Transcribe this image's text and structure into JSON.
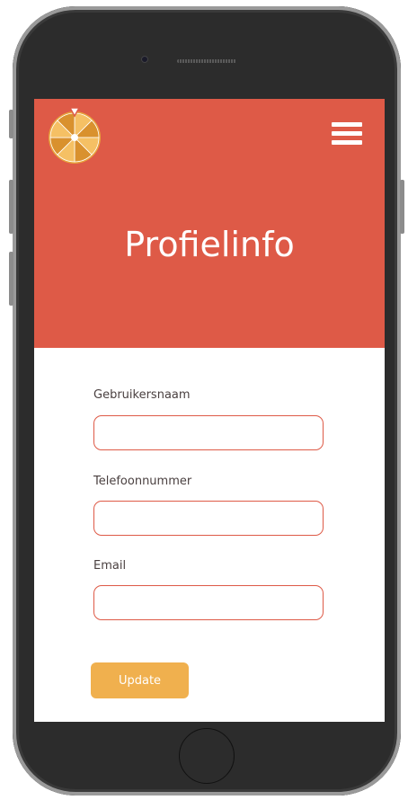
{
  "colors": {
    "header_bg": "#de5a47",
    "input_border": "#de5a47",
    "button_bg": "#f0b04e",
    "logo_light": "#f5c064",
    "logo_dark": "#d9912e",
    "logo_rim": "#e8a43c",
    "pointer": "#de5a47"
  },
  "header": {
    "logo_icon": "prize-wheel-icon",
    "menu_icon": "hamburger-menu-icon",
    "title": "Profielinfo"
  },
  "form": {
    "fields": [
      {
        "label": "Gebruikersnaam",
        "value": "",
        "placeholder": ""
      },
      {
        "label": "Telefoonnummer",
        "value": "",
        "placeholder": ""
      },
      {
        "label": "Email",
        "value": "",
        "placeholder": ""
      }
    ],
    "submit_label": "Update"
  }
}
